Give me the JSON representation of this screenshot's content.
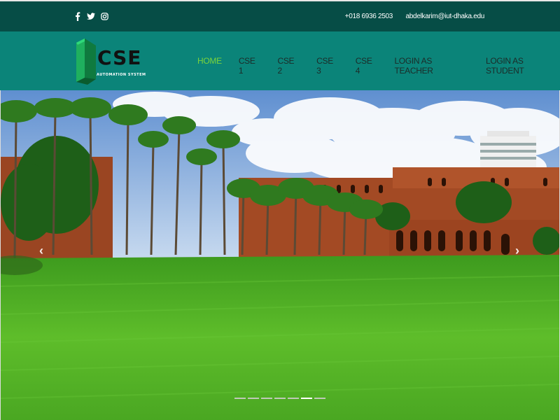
{
  "topbar": {
    "social": [
      {
        "icon": "facebook-icon"
      },
      {
        "icon": "twitter-icon"
      },
      {
        "icon": "instagram-icon"
      }
    ],
    "phone": "+018 6936 2503",
    "email": "abdelkarim@iut-dhaka.edu"
  },
  "logo": {
    "title": "CSE",
    "subtitle": "AUTOMATION SYSTEM"
  },
  "nav": {
    "home": "HOME",
    "cse1": "CSE 1",
    "cse2": "CSE 2",
    "cse3": "CSE 3",
    "cse4": "CSE 4",
    "login_teacher": "LOGIN AS TEACHER",
    "login_student": "LOGIN AS STUDENT"
  },
  "slider": {
    "prev": "‹",
    "next": "›",
    "slide_count": 7,
    "active_slide": 6
  },
  "colors": {
    "topbar": "#064d46",
    "navbar": "#0b8479",
    "active_nav": "#7bd33b"
  }
}
